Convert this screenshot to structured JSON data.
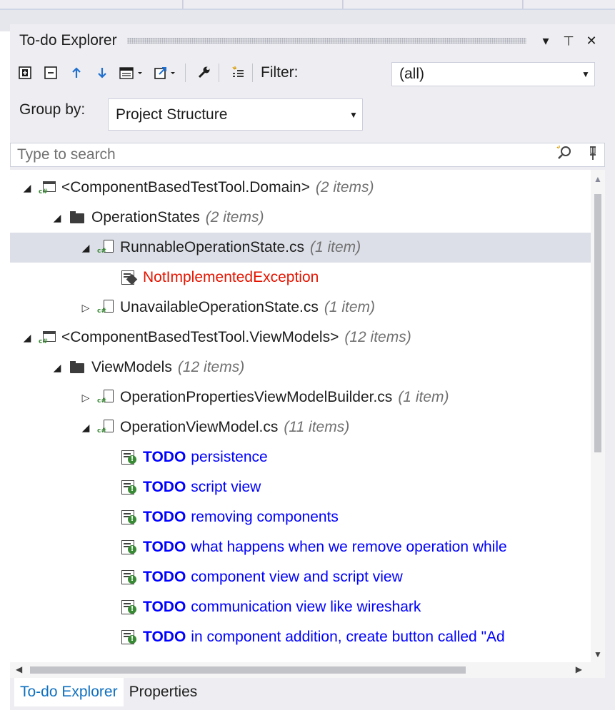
{
  "window": {
    "title": "To-do Explorer",
    "dropdown_glyph": "▾",
    "pin_glyph": "⊥",
    "close_glyph": "✕"
  },
  "toolbar": {
    "icons": [
      "expand-all-icon",
      "collapse-all-icon",
      "move-up-icon",
      "move-down-icon",
      "columns-icon",
      "export-icon",
      "settings-icon",
      "todo-list-icon"
    ],
    "filter_label": "Filter:",
    "filter_value": "(all)"
  },
  "groupby": {
    "label": "Group by:",
    "value": "Project Structure"
  },
  "search": {
    "placeholder": "Type to search"
  },
  "tree": {
    "rows": [
      {
        "level": 0,
        "expanded": true,
        "icon": "csproj",
        "name": "<ComponentBasedTestTool.Domain>",
        "count": "(2 items)"
      },
      {
        "level": 1,
        "expanded": true,
        "icon": "folder",
        "name": "OperationStates",
        "count": "(2 items)"
      },
      {
        "level": 2,
        "expanded": true,
        "icon": "csfile",
        "name": "RunnableOperationState.cs",
        "count": "(1 item)",
        "selected": true
      },
      {
        "level": 3,
        "icon": "error",
        "name": "NotImplementedException"
      },
      {
        "level": 2,
        "expanded": false,
        "icon": "csfile",
        "name": "UnavailableOperationState.cs",
        "count": "(1 item)"
      },
      {
        "level": 0,
        "expanded": true,
        "icon": "csproj",
        "name": "<ComponentBasedTestTool.ViewModels>",
        "count": "(12 items)"
      },
      {
        "level": 1,
        "expanded": true,
        "icon": "folder",
        "name": "ViewModels",
        "count": "(12 items)"
      },
      {
        "level": 2,
        "expanded": false,
        "icon": "csfile",
        "name": "OperationPropertiesViewModelBuilder.cs",
        "count": "(1 item)"
      },
      {
        "level": 2,
        "expanded": true,
        "icon": "csfile",
        "name": "OperationViewModel.cs",
        "count": "(11 items)"
      },
      {
        "level": 3,
        "icon": "todo",
        "keyword": "TODO",
        "name": "persistence"
      },
      {
        "level": 3,
        "icon": "todo",
        "keyword": "TODO",
        "name": "script view"
      },
      {
        "level": 3,
        "icon": "todo",
        "keyword": "TODO",
        "name": "removing components"
      },
      {
        "level": 3,
        "icon": "todo",
        "keyword": "TODO",
        "name": "what happens when we remove operation while"
      },
      {
        "level": 3,
        "icon": "todo",
        "keyword": "TODO",
        "name": "component view and script view"
      },
      {
        "level": 3,
        "icon": "todo",
        "keyword": "TODO",
        "name": "communication view like wireshark"
      },
      {
        "level": 3,
        "icon": "todo",
        "keyword": "TODO",
        "name": "in component addition, create button called \"Ad"
      }
    ]
  },
  "tabs": {
    "todo_explorer": "To-do Explorer",
    "properties": "Properties"
  },
  "colors": {
    "panel_bg": "#eeeef2",
    "selected_row": "#dcdfe7",
    "error_text": "#e51400",
    "todo_text": "#0000ff",
    "count_text": "#717171",
    "active_tab": "#0e70c0"
  }
}
